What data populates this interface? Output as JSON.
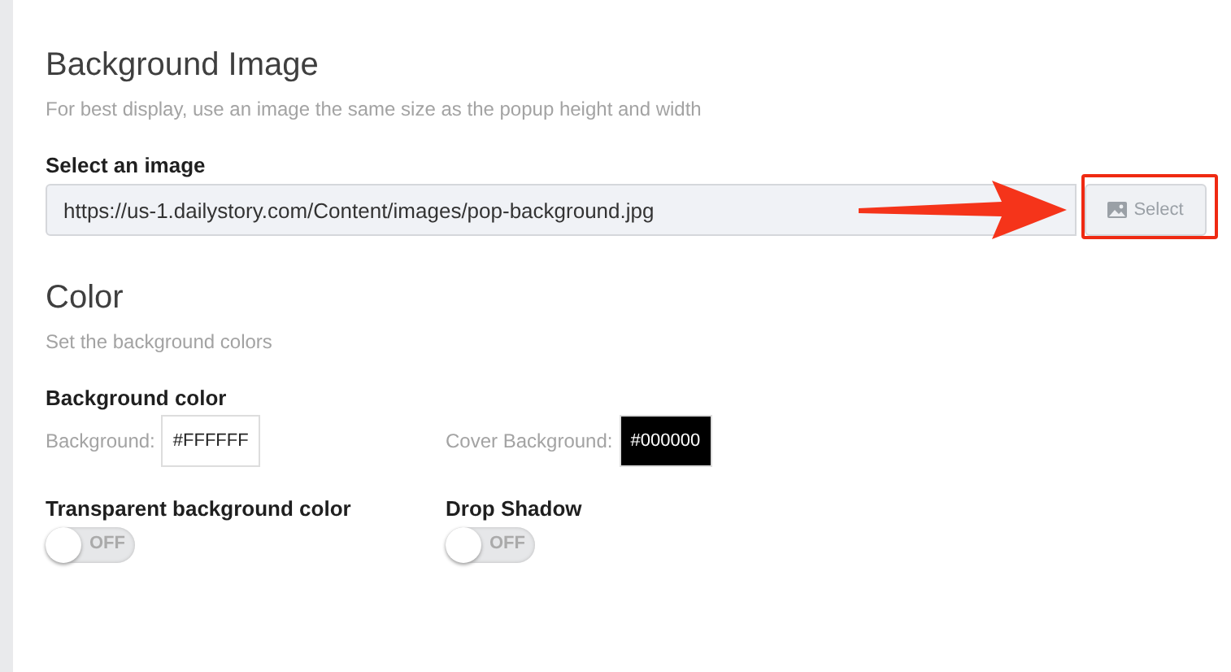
{
  "sections": [
    {
      "title": "Background Image",
      "subtitle": "For best display, use an image the same size as the popup height and width",
      "image_field": {
        "label": "Select an image",
        "value": "https://us-1.dailystory.com/Content/images/pop-background.jpg",
        "button": "Select"
      }
    },
    {
      "title": "Color",
      "subtitle": "Set the background colors",
      "color_group": {
        "label": "Background color",
        "fields": [
          {
            "label": "Background:",
            "value": "#FFFFFF",
            "color": "#ffffff"
          },
          {
            "label": "Cover Background:",
            "value": "#000000",
            "color": "#000000"
          }
        ]
      },
      "toggles": [
        {
          "label": "Transparent background color",
          "on": false,
          "text": "OFF"
        },
        {
          "label": "Drop Shadow",
          "on": false,
          "text": "OFF"
        }
      ]
    }
  ]
}
